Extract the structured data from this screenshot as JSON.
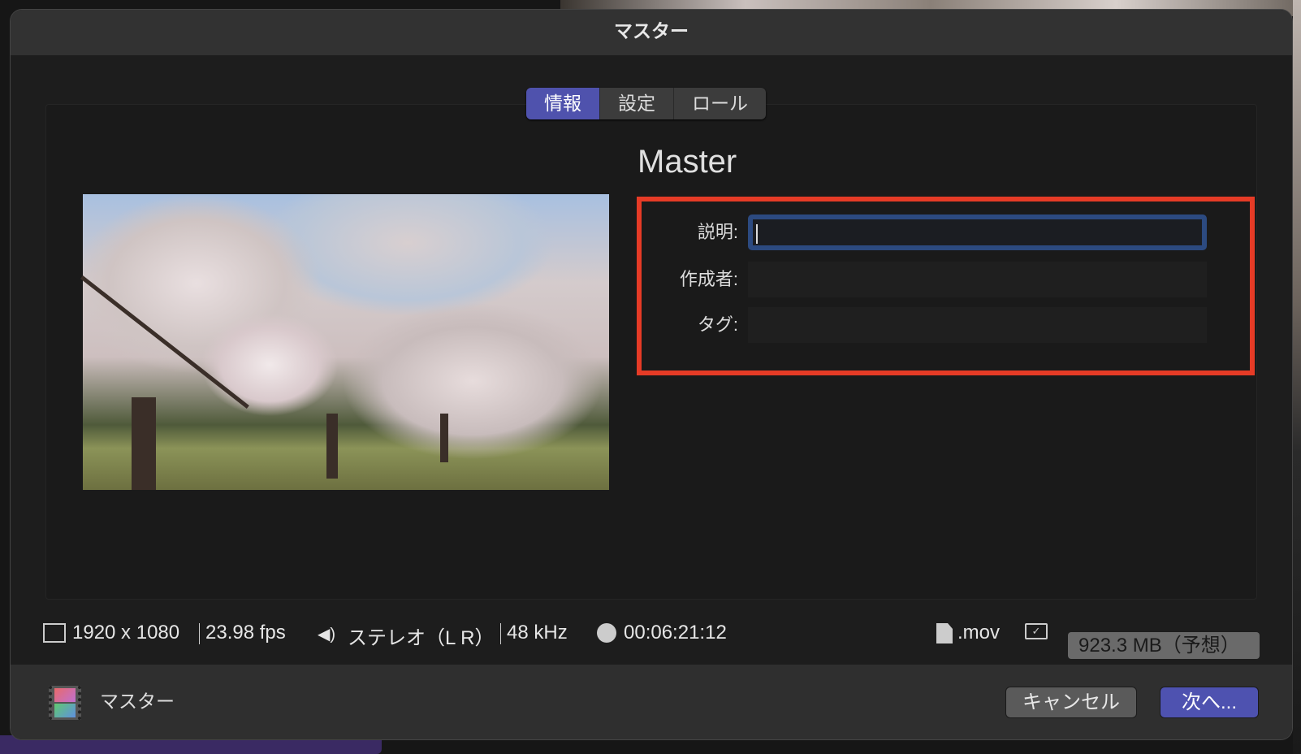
{
  "window_title": "マスター",
  "tabs": [
    {
      "label": "情報",
      "active": true
    },
    {
      "label": "設定",
      "active": false
    },
    {
      "label": "ロール",
      "active": false
    }
  ],
  "clip_name": "Master",
  "fields": {
    "description": {
      "label": "説明:",
      "value": ""
    },
    "creator": {
      "label": "作成者:",
      "value": ""
    },
    "tags": {
      "label": "タグ:",
      "value": ""
    }
  },
  "status": {
    "resolution": "1920 x 1080",
    "frame_rate": "23.98 fps",
    "audio": "ステレオ（L R）",
    "sample_rate": "48 kHz",
    "duration": "00:06:21:12",
    "extension": ".mov",
    "file_size": "923.3 MB（予想）"
  },
  "footer": {
    "destination": "マスター",
    "cancel_label": "キャンセル",
    "next_label": "次へ..."
  },
  "colors": {
    "accent": "#4f52ad",
    "highlight": "#e63b26",
    "focus": "#2c4a80"
  }
}
